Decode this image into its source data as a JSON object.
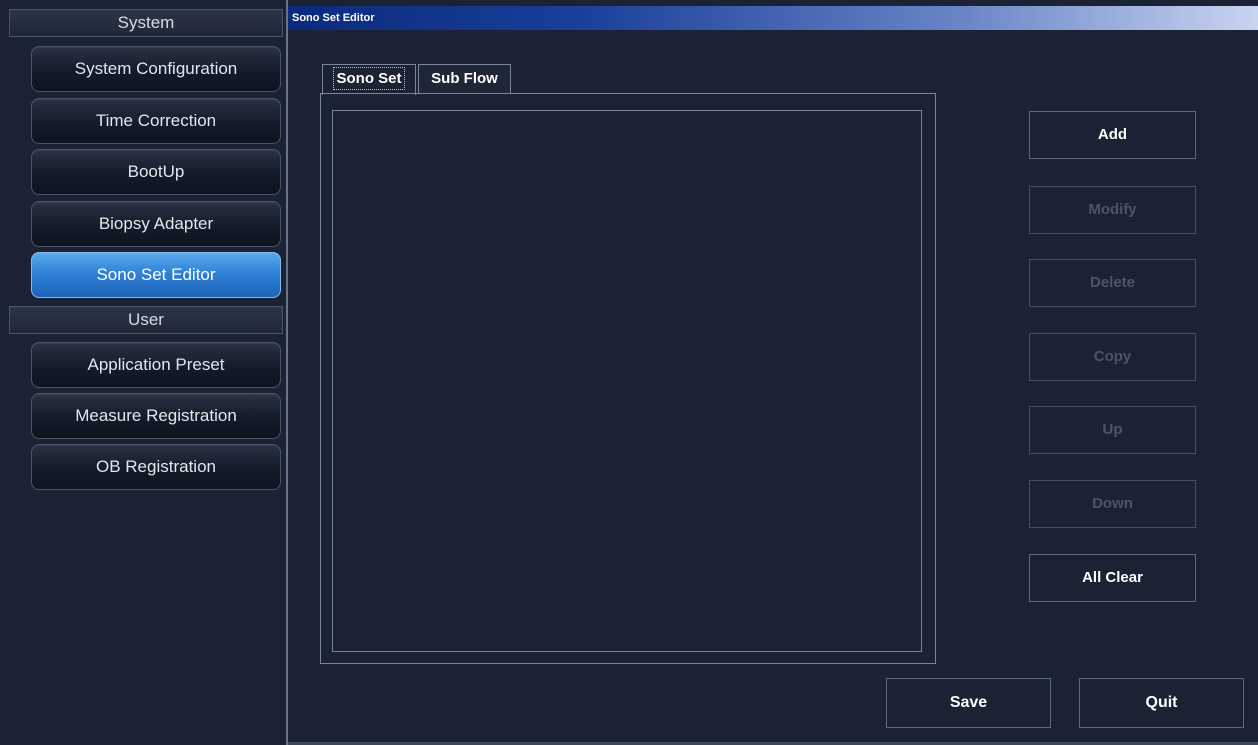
{
  "sidebar": {
    "system_header": "System",
    "system_items": [
      {
        "label": "System Configuration"
      },
      {
        "label": "Time Correction"
      },
      {
        "label": "BootUp"
      },
      {
        "label": "Biopsy Adapter"
      },
      {
        "label": "Sono Set Editor",
        "active": true
      }
    ],
    "user_header": "User",
    "user_items": [
      {
        "label": "Application Preset"
      },
      {
        "label": "Measure Registration"
      },
      {
        "label": "OB Registration"
      }
    ]
  },
  "window": {
    "title": "Sono Set Editor"
  },
  "tabs": [
    {
      "label": "Sono Set",
      "selected": true
    },
    {
      "label": "Sub Flow",
      "selected": false
    }
  ],
  "actions": {
    "add": "Add",
    "modify": "Modify",
    "delete": "Delete",
    "copy": "Copy",
    "up": "Up",
    "down": "Down",
    "all_clear": "All Clear"
  },
  "footer": {
    "save": "Save",
    "quit": "Quit"
  },
  "colors": {
    "active_nav": "#2d7ed6",
    "titlebar_start": "#0a2a7c",
    "titlebar_end": "#c8d4f0",
    "panel_bg": "#1a2233",
    "disabled_text": "#4c5566"
  }
}
